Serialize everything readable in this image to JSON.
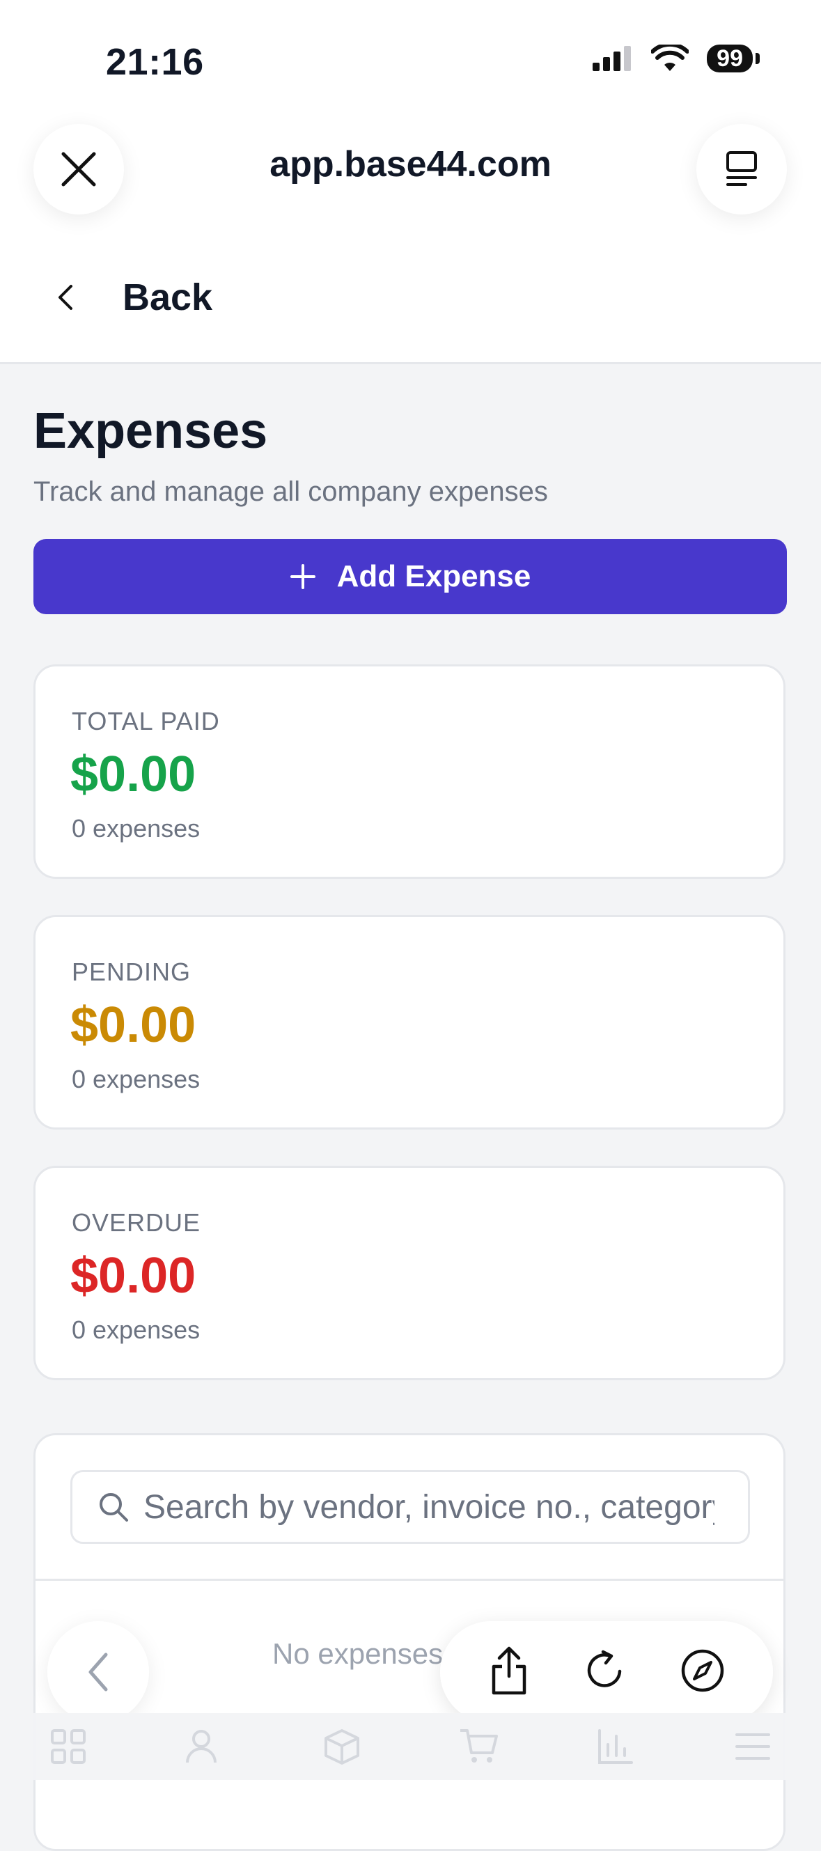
{
  "status": {
    "time": "21:16",
    "battery": "99"
  },
  "browser": {
    "url": "app.base44.com"
  },
  "nav": {
    "back_label": "Back"
  },
  "header": {
    "title": "Expenses",
    "subtitle": "Track and manage all company expenses"
  },
  "actions": {
    "add_label": "Add Expense"
  },
  "stats": [
    {
      "label": "TOTAL PAID",
      "value": "$0.00",
      "count": "0 expenses",
      "color": "#16a34a"
    },
    {
      "label": "PENDING",
      "value": "$0.00",
      "count": "0 expenses",
      "color": "#ca8a04"
    },
    {
      "label": "OVERDUE",
      "value": "$0.00",
      "count": "0 expenses",
      "color": "#dc2626"
    }
  ],
  "search": {
    "placeholder": "Search by vendor, invoice no., category..."
  },
  "list": {
    "empty_text": "No expenses"
  },
  "tabs": [
    "dashboard-icon",
    "users-icon",
    "package-icon",
    "cart-icon",
    "chart-icon",
    "menu-icon"
  ],
  "colors": {
    "accent": "#4838cc"
  }
}
